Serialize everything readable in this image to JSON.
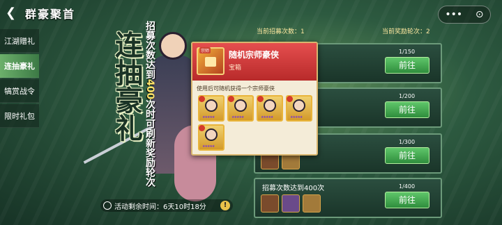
{
  "header": {
    "title": "群豪聚首",
    "back_icon": "back-arrow-icon"
  },
  "capsule": {
    "more_label": "•••",
    "close_label": "⊙"
  },
  "sidebar": {
    "items": [
      {
        "label": "江湖赠礼"
      },
      {
        "label": "连抽豪礼"
      },
      {
        "label": "犒赏战令"
      },
      {
        "label": "限时礼包"
      }
    ]
  },
  "banner": {
    "calligraphy": "连抽豪礼",
    "description_prefix": "招募次数达到",
    "description_number": "400",
    "description_suffix": "次时可刷新奖励轮次"
  },
  "timer": {
    "label": "活动剩余时间：",
    "value": "6天10时18分",
    "warn": "!"
  },
  "counters": {
    "left": "当前招募次数：1",
    "right": "当前奖励轮次：2"
  },
  "cards": [
    {
      "title": "",
      "progress": "1/150",
      "button": "前往"
    },
    {
      "title": "",
      "progress": "1/200",
      "button": "前往"
    },
    {
      "title": "",
      "progress": "1/300",
      "button": "前往"
    },
    {
      "title": "招募次数达到400次",
      "progress": "1/400",
      "button": "前往"
    }
  ],
  "popup": {
    "item_name": "随机宗师豪侠",
    "item_type": "宝箱",
    "tag": "宗师",
    "description": "使用后可随机获得一个宗师豪侠",
    "hero_count": 5
  }
}
